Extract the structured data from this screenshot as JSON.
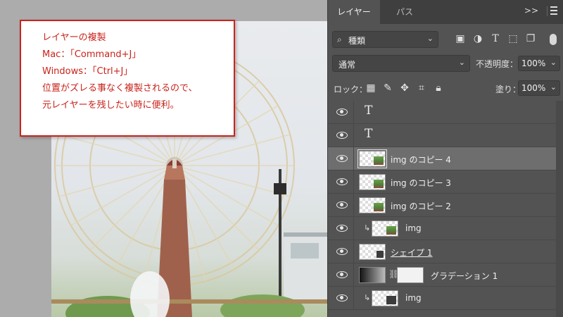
{
  "callout": {
    "lines": [
      "レイヤーの複製",
      "Mac：「Command+J」",
      "Windows：「Ctrl+J」",
      "位置がズレる事なく複製されるので、",
      "元レイヤーを残したい時に便利。"
    ]
  },
  "panel": {
    "tabs": [
      "レイヤー",
      "パス"
    ],
    "collapse_glyph": ">>",
    "filter": {
      "label": "種類",
      "icons": [
        "image-filter-icon",
        "adjustment-filter-icon",
        "type-filter-icon",
        "shape-filter-icon",
        "smart-object-filter-icon"
      ]
    },
    "blend_mode": "通常",
    "opacity_label": "不透明度：",
    "opacity_value": "100%",
    "lock_label": "ロック：",
    "lock_icons": [
      "lock-transparency-icon",
      "lock-pixels-icon",
      "lock-position-icon",
      "lock-artboard-icon",
      "lock-all-icon"
    ],
    "fill_label": "塗り：",
    "fill_value": "100%"
  },
  "layers": [
    {
      "kind": "type",
      "name": "",
      "glyph": "T"
    },
    {
      "kind": "type",
      "name": "",
      "glyph": "T"
    },
    {
      "kind": "image",
      "name": "img のコピー 4",
      "selected": true
    },
    {
      "kind": "image",
      "name": "img のコピー 3"
    },
    {
      "kind": "image",
      "name": "img のコピー 2"
    },
    {
      "kind": "clipped-image",
      "name": "img"
    },
    {
      "kind": "shape",
      "name": "シェイプ 1"
    },
    {
      "kind": "gradient",
      "name": "グラデーション 1"
    },
    {
      "kind": "clipped-image",
      "name": "img"
    }
  ]
}
